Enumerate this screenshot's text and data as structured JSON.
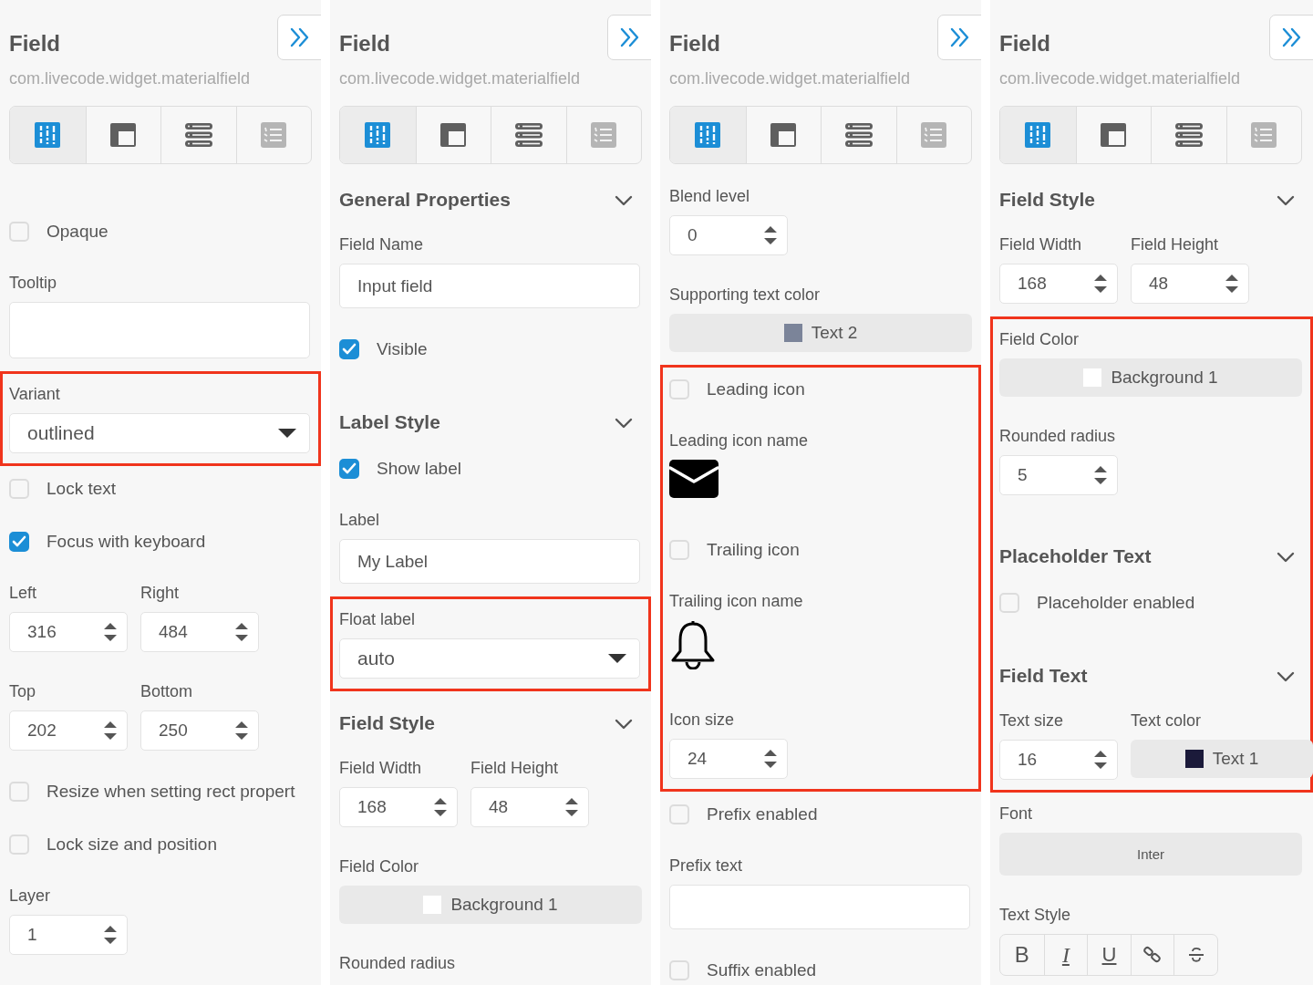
{
  "panels": [
    {
      "title": "Field",
      "subtitle": "com.livecode.widget.materialfield",
      "tabs": [
        {
          "selected": true,
          "disabled": false
        },
        {
          "selected": false,
          "disabled": false
        },
        {
          "selected": false,
          "disabled": false
        },
        {
          "selected": false,
          "disabled": true
        }
      ],
      "rows": [
        {
          "kind": "checkbox",
          "label": "Opaque",
          "checked": false
        },
        {
          "kind": "textarea",
          "label": "Tooltip"
        },
        {
          "kind": "group",
          "highlighted": true,
          "rows": [
            {
              "kind": "select",
              "label": "Variant",
              "value": "outlined"
            }
          ]
        },
        {
          "kind": "checkbox",
          "label": "Lock text",
          "checked": false
        },
        {
          "kind": "checkbox",
          "label": "Focus with keyboard",
          "checked": true
        },
        {
          "kind": "pair",
          "fields": [
            {
              "kind": "spinner",
              "label": "Left",
              "value": "316"
            },
            {
              "kind": "spinner",
              "label": "Right",
              "value": "484"
            }
          ]
        },
        {
          "kind": "pair",
          "fields": [
            {
              "kind": "spinner",
              "label": "Top",
              "value": "202"
            },
            {
              "kind": "spinner",
              "label": "Bottom",
              "value": "250"
            }
          ]
        },
        {
          "kind": "checkbox",
          "label": "Resize when setting rect propert",
          "checked": false
        },
        {
          "kind": "checkbox",
          "label": "Lock size and position",
          "checked": false
        },
        {
          "kind": "spinner",
          "label": "Layer",
          "value": "1"
        }
      ]
    },
    {
      "title": "Field",
      "subtitle": "com.livecode.widget.materialfield",
      "tabs": [
        {
          "selected": true,
          "disabled": false
        },
        {
          "selected": false,
          "disabled": false
        },
        {
          "selected": false,
          "disabled": false
        },
        {
          "selected": false,
          "disabled": true
        }
      ],
      "rows": [
        {
          "kind": "section",
          "title": "General Properties",
          "expanded": true
        },
        {
          "kind": "input",
          "label": "Field Name",
          "value": "Input field"
        },
        {
          "kind": "checkbox",
          "label": "Visible",
          "checked": true
        },
        {
          "kind": "section",
          "title": "Label Style",
          "expanded": true
        },
        {
          "kind": "checkbox",
          "label": "Show label",
          "checked": true
        },
        {
          "kind": "input",
          "label": "Label",
          "value": "My Label"
        },
        {
          "kind": "group",
          "highlighted": true,
          "rows": [
            {
              "kind": "select",
              "label": "Float label",
              "value": "auto"
            }
          ]
        },
        {
          "kind": "section",
          "title": "Field Style",
          "expanded": true
        },
        {
          "kind": "pair",
          "fields": [
            {
              "kind": "spinner",
              "label": "Field Width",
              "value": "168"
            },
            {
              "kind": "spinner",
              "label": "Field Height",
              "value": "48"
            }
          ]
        },
        {
          "kind": "color",
          "label": "Field Color",
          "value": "Background 1",
          "color": "#ffffff"
        },
        {
          "kind": "label",
          "label": "Rounded radius"
        }
      ]
    },
    {
      "title": "Field",
      "subtitle": "com.livecode.widget.materialfield",
      "tabs": [
        {
          "selected": true,
          "disabled": false
        },
        {
          "selected": false,
          "disabled": false
        },
        {
          "selected": false,
          "disabled": false
        },
        {
          "selected": false,
          "disabled": true
        }
      ],
      "rows": [
        {
          "kind": "spinner",
          "label": "Blend level",
          "value": "0"
        },
        {
          "kind": "color",
          "label": "Supporting text color",
          "value": "Text 2",
          "color": "#7b8499"
        },
        {
          "kind": "group",
          "highlighted": true,
          "rows": [
            {
              "kind": "checkbox",
              "label": "Leading icon",
              "checked": false
            },
            {
              "kind": "icon",
              "label": "Leading icon name"
            },
            {
              "kind": "checkbox",
              "label": "Trailing icon",
              "checked": false
            },
            {
              "kind": "icon",
              "label": "Trailing icon name"
            },
            {
              "kind": "spinner",
              "label": "Icon size",
              "value": "24"
            }
          ]
        },
        {
          "kind": "checkbox",
          "label": "Prefix enabled",
          "checked": false
        },
        {
          "kind": "input",
          "label": "Prefix text"
        },
        {
          "kind": "checkbox",
          "label": "Suffix enabled",
          "checked": false
        }
      ]
    },
    {
      "title": "Field",
      "subtitle": "com.livecode.widget.materialfield",
      "tabs": [
        {
          "selected": true,
          "disabled": false
        },
        {
          "selected": false,
          "disabled": false
        },
        {
          "selected": false,
          "disabled": false
        },
        {
          "selected": false,
          "disabled": true
        }
      ],
      "rows": [
        {
          "kind": "section",
          "title": "Field Style",
          "expanded": true
        },
        {
          "kind": "pair",
          "fields": [
            {
              "kind": "spinner",
              "label": "Field Width",
              "value": "168"
            },
            {
              "kind": "spinner",
              "label": "Field Height",
              "value": "48"
            }
          ]
        },
        {
          "kind": "group",
          "highlighted": true,
          "rows": [
            {
              "kind": "color",
              "label": "Field Color",
              "value": "Background 1",
              "color": "#ffffff"
            },
            {
              "kind": "spinner",
              "label": "Rounded radius",
              "value": "5"
            },
            {
              "kind": "section",
              "title": "Placeholder Text",
              "expanded": true
            },
            {
              "kind": "checkbox",
              "label": "Placeholder enabled",
              "checked": false
            },
            {
              "kind": "section",
              "title": "Field Text",
              "expanded": true
            },
            {
              "kind": "pair",
              "fields": [
                {
                  "kind": "spinner",
                  "label": "Text size",
                  "value": "16"
                },
                {
                  "kind": "color",
                  "label": "Text color",
                  "value": "Text 1",
                  "color": "#1b1a3a"
                }
              ]
            }
          ]
        },
        {
          "kind": "font",
          "label": "Font",
          "value": "Inter"
        },
        {
          "kind": "textstyle",
          "label": "Text Style",
          "buttons": [
            "B",
            "I",
            "U"
          ]
        }
      ]
    }
  ]
}
